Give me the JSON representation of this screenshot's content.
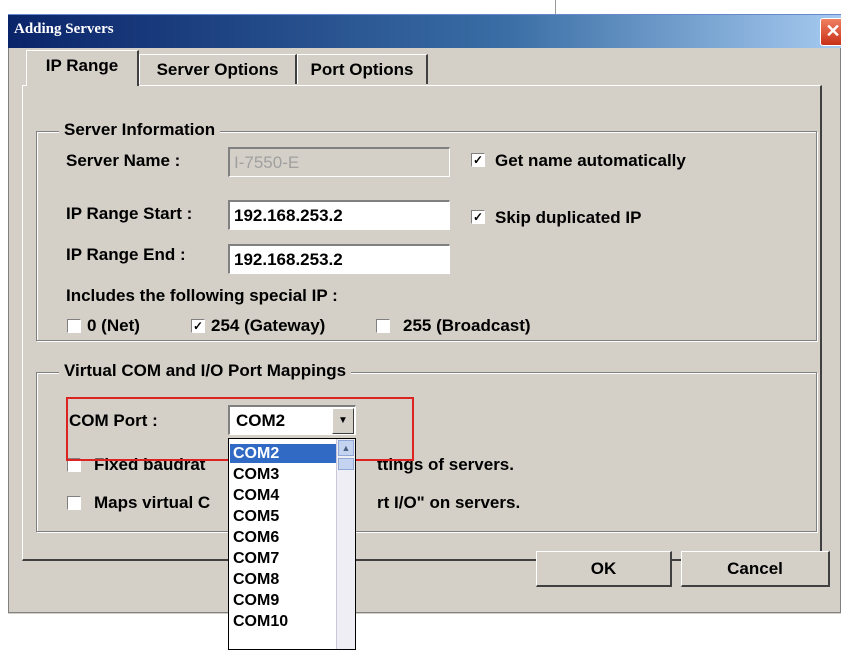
{
  "window": {
    "title": "Adding Servers",
    "close_label": "✕"
  },
  "tabs": [
    {
      "label": "IP Range",
      "active": true
    },
    {
      "label": "Server Options",
      "active": false
    },
    {
      "label": "Port Options",
      "active": false
    }
  ],
  "server_info": {
    "legend": "Server Information",
    "server_name_label": "Server Name :",
    "server_name_value": "I-7550-E",
    "get_name_auto_label": "Get name automatically",
    "get_name_auto_checked": true,
    "ip_start_label": "IP Range Start :",
    "ip_start_value": "192.168.253.2",
    "skip_dup_label": "Skip duplicated IP",
    "skip_dup_checked": true,
    "ip_end_label": "IP Range End :",
    "ip_end_value": "192.168.253.2",
    "special_ip_label": "Includes the following special IP :",
    "special": [
      {
        "label": "0 (Net)",
        "checked": false
      },
      {
        "label": "254 (Gateway)",
        "checked": true
      },
      {
        "label": "255 (Broadcast)",
        "checked": false
      }
    ]
  },
  "virtual_com": {
    "legend": "Virtual COM and I/O Port Mappings",
    "com_port_label": "COM Port :",
    "com_port_value": "COM2",
    "fixed_baud_left": "Fixed baudrat",
    "fixed_baud_right": "ttings of servers.",
    "maps_left": "Maps virtual C",
    "maps_right": "rt I/O\" on servers.",
    "options": [
      "COM2",
      "COM3",
      "COM4",
      "COM5",
      "COM6",
      "COM7",
      "COM8",
      "COM9",
      "COM10"
    ],
    "selected_index": 0
  },
  "buttons": {
    "ok": "OK",
    "cancel": "Cancel"
  },
  "glyphs": {
    "check": "✓",
    "arrow_down": "▼",
    "arrow_up": "▲"
  }
}
